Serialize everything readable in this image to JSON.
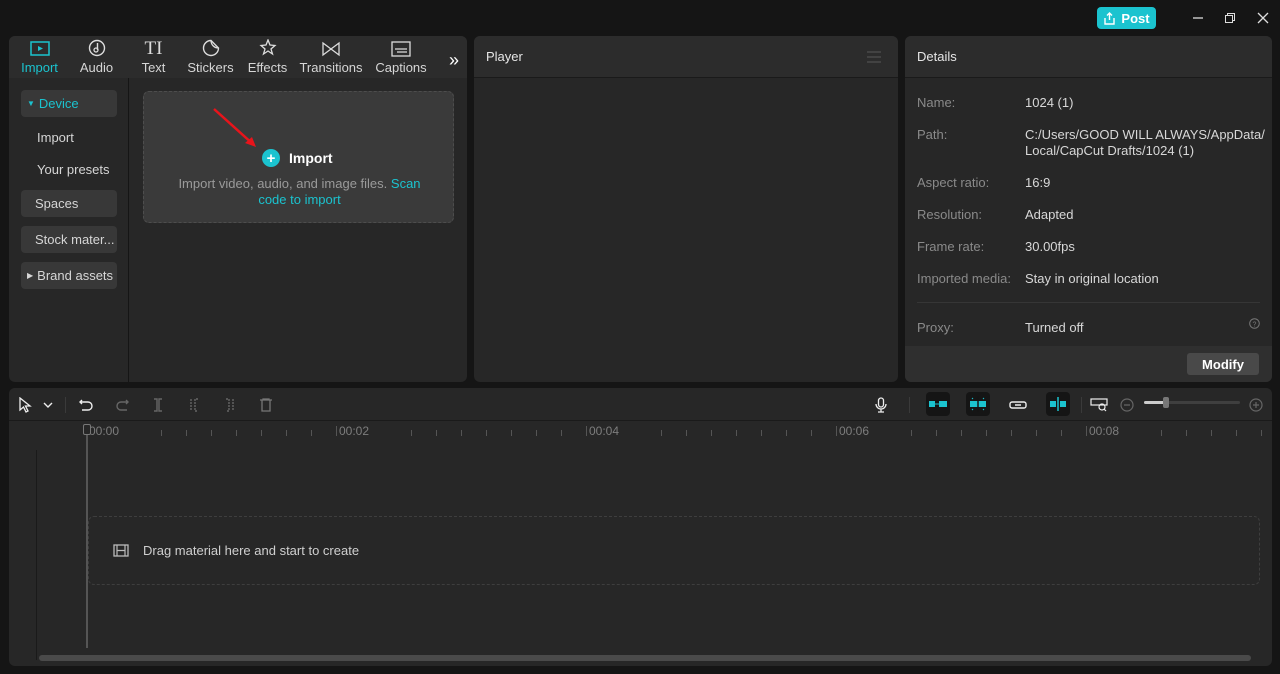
{
  "titlebar": {
    "post_label": "Post",
    "colors": {
      "accent": "#1bc3cf"
    }
  },
  "media_panel": {
    "tabs": [
      {
        "label": "Import",
        "icon": "import-icon",
        "active": true
      },
      {
        "label": "Audio",
        "icon": "audio-icon"
      },
      {
        "label": "Text",
        "icon": "text-icon"
      },
      {
        "label": "Stickers",
        "icon": "sticker-icon"
      },
      {
        "label": "Effects",
        "icon": "effects-icon"
      },
      {
        "label": "Transitions",
        "icon": "transitions-icon"
      },
      {
        "label": "Captions",
        "icon": "captions-icon"
      }
    ],
    "sidebar": [
      {
        "label": "Device",
        "expanded": true,
        "active": true
      },
      {
        "label": "Import"
      },
      {
        "label": "Your presets"
      },
      {
        "label": "Spaces"
      },
      {
        "label": "Stock mater..."
      },
      {
        "label": "Brand assets",
        "expanded": false
      }
    ],
    "import_box": {
      "title": "Import",
      "description": "Import video, audio, and image files.",
      "link": "Scan code to import"
    }
  },
  "player": {
    "title": "Player"
  },
  "details": {
    "title": "Details",
    "rows": [
      {
        "label": "Name:",
        "value": "1024 (1)"
      },
      {
        "label": "Path:",
        "value": "C:/Users/GOOD WILL ALWAYS/AppData/ Local/CapCut Drafts/1024 (1)"
      },
      {
        "label": "Aspect ratio:",
        "value": "16:9"
      },
      {
        "label": "Resolution:",
        "value": "Adapted"
      },
      {
        "label": "Frame rate:",
        "value": "30.00fps"
      },
      {
        "label": "Imported media:",
        "value": "Stay in original location"
      },
      {
        "label": "Proxy:",
        "value": "Turned off"
      }
    ],
    "modify_label": "Modify"
  },
  "timeline": {
    "ruler_labels": [
      "00:00",
      "00:02",
      "00:04",
      "00:06",
      "00:08"
    ],
    "drop_hint": "Drag material here and start to create",
    "zoom_level": 0.2
  }
}
